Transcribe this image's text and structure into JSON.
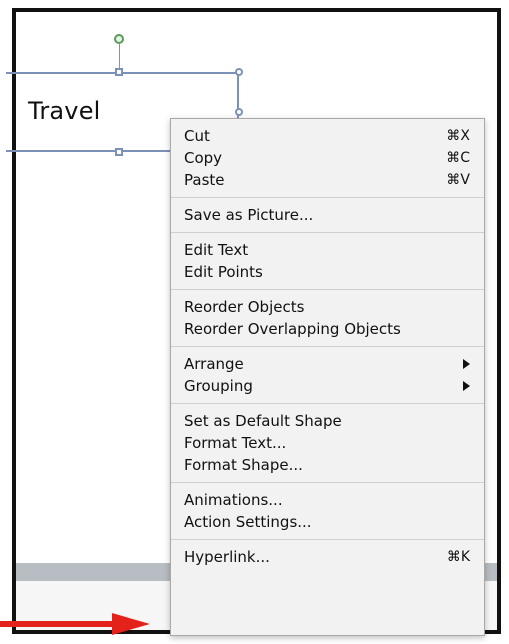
{
  "shape": {
    "text": "Travel"
  },
  "menu": {
    "groups": [
      {
        "items": [
          {
            "label": "Cut",
            "shortcut": "⌘X"
          },
          {
            "label": "Copy",
            "shortcut": "⌘C"
          },
          {
            "label": "Paste",
            "shortcut": "⌘V"
          }
        ]
      },
      {
        "items": [
          {
            "label": "Save as Picture..."
          }
        ]
      },
      {
        "items": [
          {
            "label": "Edit Text"
          },
          {
            "label": "Edit Points"
          }
        ]
      },
      {
        "items": [
          {
            "label": "Reorder Objects"
          },
          {
            "label": "Reorder Overlapping Objects"
          }
        ]
      },
      {
        "items": [
          {
            "label": "Arrange",
            "submenu": true
          },
          {
            "label": "Grouping",
            "submenu": true
          }
        ]
      },
      {
        "items": [
          {
            "label": "Set as Default Shape"
          },
          {
            "label": "Format Text..."
          },
          {
            "label": "Format Shape..."
          }
        ]
      },
      {
        "items": [
          {
            "label": "Animations..."
          },
          {
            "label": "Action Settings..."
          }
        ]
      },
      {
        "items": [
          {
            "label": "Hyperlink...",
            "shortcut": "⌘K"
          }
        ]
      }
    ]
  },
  "colors": {
    "arrow": "#e3231b",
    "selection": "#7b91b8",
    "rotate": "#5d9a5e"
  },
  "icons": {
    "pointer": "red-arrow-icon",
    "submenu": "submenu-triangle-icon"
  }
}
